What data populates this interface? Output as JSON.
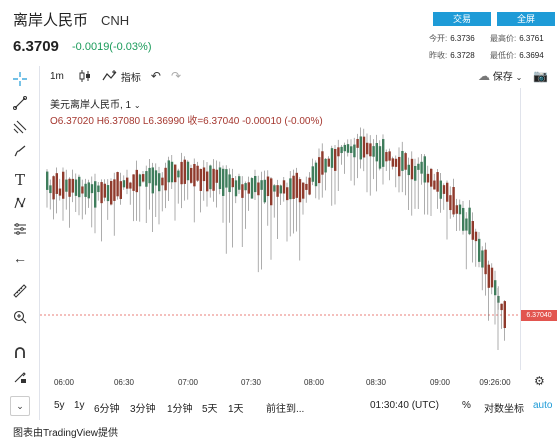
{
  "header": {
    "name": "离岸人民币",
    "code": "CNH",
    "price": "6.3709",
    "change": "-0.0019(-0.03%)",
    "trade_label": "交易",
    "fullscreen_label": "全屏",
    "open_label": "今开:",
    "open_value": "6.3736",
    "high_label": "最高价:",
    "high_value": "6.3761",
    "prev_close_label": "昨收:",
    "prev_close_value": "6.3728",
    "low_label": "最低价:",
    "low_value": "6.3694"
  },
  "toolbar": {
    "interval": "1m",
    "indicators_label": "指标",
    "save_label": "保存"
  },
  "legend": {
    "symbol": "美元离岸人民币, 1",
    "ohlc": "O6.37020  H6.37080  L6.36990  收=6.37040  -0.00010 (-0.00%)"
  },
  "price_axis": {
    "current_price": "6.37040"
  },
  "time_axis": [
    "06:00",
    "06:30",
    "07:00",
    "07:30",
    "08:00",
    "08:30",
    "09:00",
    "09:26:00"
  ],
  "bottom": {
    "ranges": [
      "5y",
      "1y",
      "6分钟",
      "3分钟",
      "1分钟",
      "5天",
      "1天"
    ],
    "goto_label": "前往到...",
    "clock": "01:30:40 (UTC)",
    "percent_label": "%",
    "log_label": "对数坐标",
    "auto_label": "auto"
  },
  "footer": "图表由TradingView提供",
  "colors": {
    "up": "#3f7d5c",
    "down": "#8f3a2c",
    "accent": "#1e9bd7",
    "price_line": "#e2554f",
    "change_text": "#1a9b5a"
  }
}
